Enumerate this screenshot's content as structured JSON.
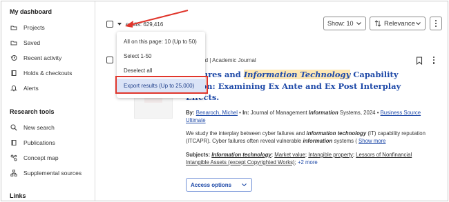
{
  "sidebar": {
    "heading_main": "My dashboard",
    "main_items": [
      {
        "label": "Projects",
        "icon": "folder-icon"
      },
      {
        "label": "Saved",
        "icon": "folder-icon"
      },
      {
        "label": "Recent activity",
        "icon": "history-icon"
      },
      {
        "label": "Holds & checkouts",
        "icon": "book-icon"
      },
      {
        "label": "Alerts",
        "icon": "bell-icon"
      }
    ],
    "heading_tools": "Research tools",
    "tool_items": [
      {
        "label": "New search",
        "icon": "search-icon"
      },
      {
        "label": "Publications",
        "icon": "book-icon"
      },
      {
        "label": "Concept map",
        "icon": "concept-map-icon"
      },
      {
        "label": "Supplemental sources",
        "icon": "network-icon"
      }
    ],
    "heading_links": "Links"
  },
  "toolbar": {
    "results_label": "Results: 629,416",
    "results_visible": "esults: 629,416",
    "show_label": "Show: 10",
    "sort_label": "Relevance"
  },
  "dropdown": {
    "items": [
      "All on this page: 10 (Up to 50)",
      "Select 1-50",
      "Deselect all",
      "Export results (Up to 25,000)"
    ],
    "active_index": 3
  },
  "result": {
    "meta_left": "reviewed",
    "meta_sep": "|",
    "meta_type": "Academic Journal",
    "title_part1": "Failures and ",
    "title_highlight": "Information Technology",
    "title_part2": " Capability",
    "title_line2": "tation: Examining Ex Ante and Ex Post Interplay",
    "title_line3": "Effects.",
    "by_label": "By:",
    "author": "Benaroch, Michel",
    "in_sep": "•",
    "in_label": "In:",
    "journal_pre": "Journal of Management ",
    "journal_bold": "Information",
    "journal_post": " Systems, 2024",
    "source": "Business Source Ultimate",
    "abstract_1": "We study the interplay between cyber failures and ",
    "abstract_bi1": "information technology",
    "abstract_2": " (IT) capability reputation (ITCAPR). Cyber failures often reveal vulnerable ",
    "abstract_bi2": "information",
    "abstract_3": " systems (",
    "show_more": "Show more",
    "subjects_label": "Subjects:",
    "subjects": [
      {
        "text": "Information technology",
        "bold_italic": true
      },
      {
        "text": "Market value",
        "bold_italic": false
      },
      {
        "text": "Intangible property",
        "bold_italic": false
      },
      {
        "text": "Lessors of Nonfinancial Intangible Assets (except Copyrighted Works)",
        "bold_italic": false
      }
    ],
    "subjects_more": "+2 more",
    "access_label": "Access options"
  },
  "colors": {
    "accent": "#1f4aa8",
    "highlight": "#fde7b4",
    "annotation_red": "#e0352b",
    "dropdown_active": "#dbe4f7"
  }
}
